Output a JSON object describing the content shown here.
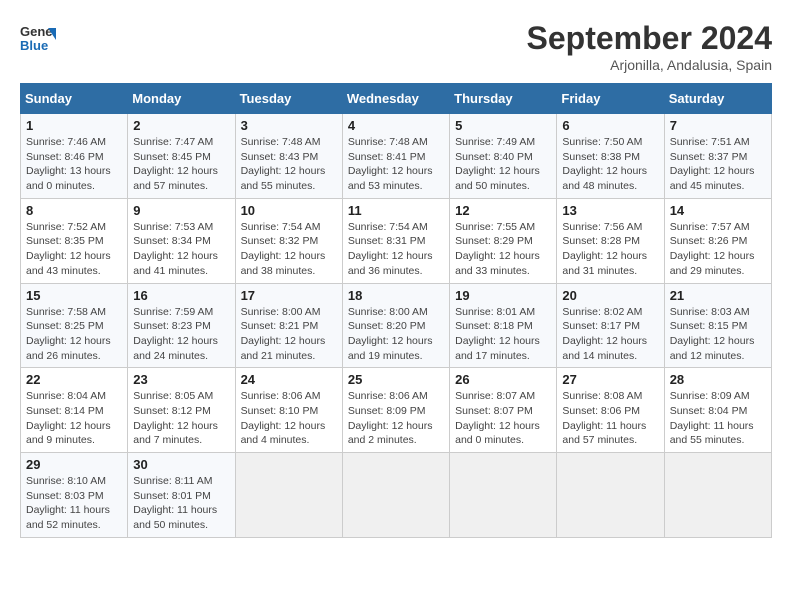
{
  "header": {
    "logo_line1": "General",
    "logo_line2": "Blue",
    "title": "September 2024",
    "subtitle": "Arjonilla, Andalusia, Spain"
  },
  "weekdays": [
    "Sunday",
    "Monday",
    "Tuesday",
    "Wednesday",
    "Thursday",
    "Friday",
    "Saturday"
  ],
  "weeks": [
    [
      {
        "day": "1",
        "info": "Sunrise: 7:46 AM\nSunset: 8:46 PM\nDaylight: 13 hours\nand 0 minutes."
      },
      {
        "day": "2",
        "info": "Sunrise: 7:47 AM\nSunset: 8:45 PM\nDaylight: 12 hours\nand 57 minutes."
      },
      {
        "day": "3",
        "info": "Sunrise: 7:48 AM\nSunset: 8:43 PM\nDaylight: 12 hours\nand 55 minutes."
      },
      {
        "day": "4",
        "info": "Sunrise: 7:48 AM\nSunset: 8:41 PM\nDaylight: 12 hours\nand 53 minutes."
      },
      {
        "day": "5",
        "info": "Sunrise: 7:49 AM\nSunset: 8:40 PM\nDaylight: 12 hours\nand 50 minutes."
      },
      {
        "day": "6",
        "info": "Sunrise: 7:50 AM\nSunset: 8:38 PM\nDaylight: 12 hours\nand 48 minutes."
      },
      {
        "day": "7",
        "info": "Sunrise: 7:51 AM\nSunset: 8:37 PM\nDaylight: 12 hours\nand 45 minutes."
      }
    ],
    [
      {
        "day": "8",
        "info": "Sunrise: 7:52 AM\nSunset: 8:35 PM\nDaylight: 12 hours\nand 43 minutes."
      },
      {
        "day": "9",
        "info": "Sunrise: 7:53 AM\nSunset: 8:34 PM\nDaylight: 12 hours\nand 41 minutes."
      },
      {
        "day": "10",
        "info": "Sunrise: 7:54 AM\nSunset: 8:32 PM\nDaylight: 12 hours\nand 38 minutes."
      },
      {
        "day": "11",
        "info": "Sunrise: 7:54 AM\nSunset: 8:31 PM\nDaylight: 12 hours\nand 36 minutes."
      },
      {
        "day": "12",
        "info": "Sunrise: 7:55 AM\nSunset: 8:29 PM\nDaylight: 12 hours\nand 33 minutes."
      },
      {
        "day": "13",
        "info": "Sunrise: 7:56 AM\nSunset: 8:28 PM\nDaylight: 12 hours\nand 31 minutes."
      },
      {
        "day": "14",
        "info": "Sunrise: 7:57 AM\nSunset: 8:26 PM\nDaylight: 12 hours\nand 29 minutes."
      }
    ],
    [
      {
        "day": "15",
        "info": "Sunrise: 7:58 AM\nSunset: 8:25 PM\nDaylight: 12 hours\nand 26 minutes."
      },
      {
        "day": "16",
        "info": "Sunrise: 7:59 AM\nSunset: 8:23 PM\nDaylight: 12 hours\nand 24 minutes."
      },
      {
        "day": "17",
        "info": "Sunrise: 8:00 AM\nSunset: 8:21 PM\nDaylight: 12 hours\nand 21 minutes."
      },
      {
        "day": "18",
        "info": "Sunrise: 8:00 AM\nSunset: 8:20 PM\nDaylight: 12 hours\nand 19 minutes."
      },
      {
        "day": "19",
        "info": "Sunrise: 8:01 AM\nSunset: 8:18 PM\nDaylight: 12 hours\nand 17 minutes."
      },
      {
        "day": "20",
        "info": "Sunrise: 8:02 AM\nSunset: 8:17 PM\nDaylight: 12 hours\nand 14 minutes."
      },
      {
        "day": "21",
        "info": "Sunrise: 8:03 AM\nSunset: 8:15 PM\nDaylight: 12 hours\nand 12 minutes."
      }
    ],
    [
      {
        "day": "22",
        "info": "Sunrise: 8:04 AM\nSunset: 8:14 PM\nDaylight: 12 hours\nand 9 minutes."
      },
      {
        "day": "23",
        "info": "Sunrise: 8:05 AM\nSunset: 8:12 PM\nDaylight: 12 hours\nand 7 minutes."
      },
      {
        "day": "24",
        "info": "Sunrise: 8:06 AM\nSunset: 8:10 PM\nDaylight: 12 hours\nand 4 minutes."
      },
      {
        "day": "25",
        "info": "Sunrise: 8:06 AM\nSunset: 8:09 PM\nDaylight: 12 hours\nand 2 minutes."
      },
      {
        "day": "26",
        "info": "Sunrise: 8:07 AM\nSunset: 8:07 PM\nDaylight: 12 hours\nand 0 minutes."
      },
      {
        "day": "27",
        "info": "Sunrise: 8:08 AM\nSunset: 8:06 PM\nDaylight: 11 hours\nand 57 minutes."
      },
      {
        "day": "28",
        "info": "Sunrise: 8:09 AM\nSunset: 8:04 PM\nDaylight: 11 hours\nand 55 minutes."
      }
    ],
    [
      {
        "day": "29",
        "info": "Sunrise: 8:10 AM\nSunset: 8:03 PM\nDaylight: 11 hours\nand 52 minutes."
      },
      {
        "day": "30",
        "info": "Sunrise: 8:11 AM\nSunset: 8:01 PM\nDaylight: 11 hours\nand 50 minutes."
      },
      {
        "day": "",
        "info": ""
      },
      {
        "day": "",
        "info": ""
      },
      {
        "day": "",
        "info": ""
      },
      {
        "day": "",
        "info": ""
      },
      {
        "day": "",
        "info": ""
      }
    ]
  ]
}
